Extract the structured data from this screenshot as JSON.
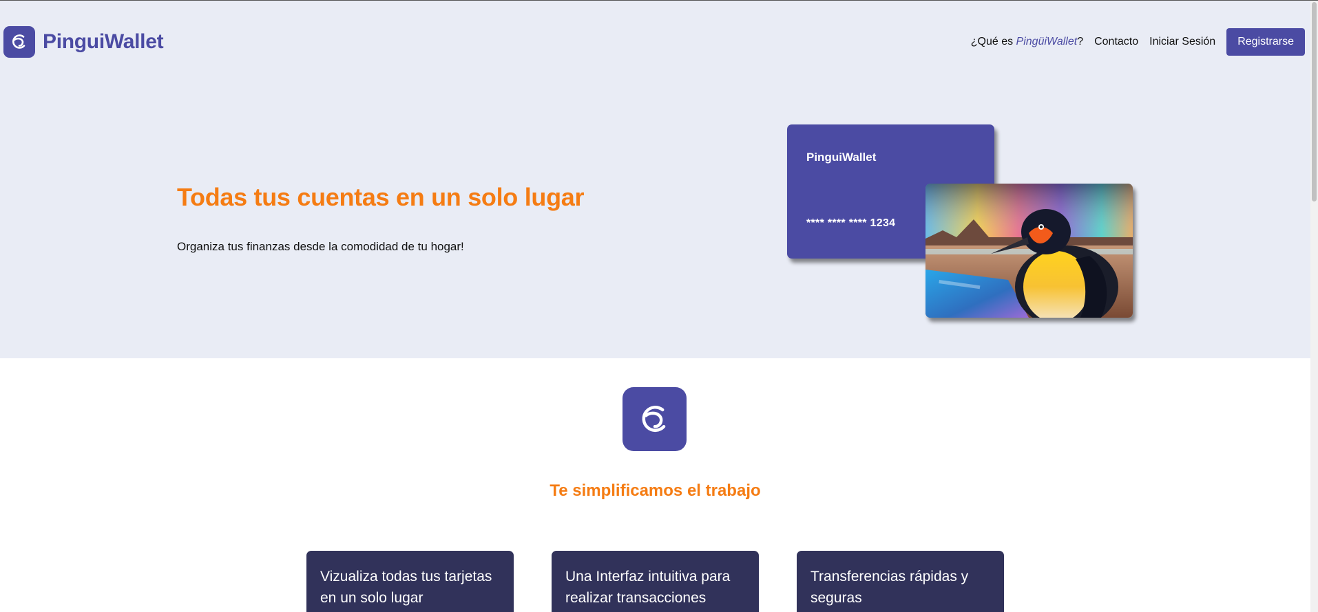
{
  "brand": {
    "name": "PinguiWallet",
    "logo_icon": "pingui-logo-icon"
  },
  "nav": {
    "que_es_prefix": "¿Qué es ",
    "que_es_brand": "PingüiWallet",
    "que_es_suffix": "?",
    "contact": "Contacto",
    "login": "Iniciar Sesión",
    "register": "Registrarse"
  },
  "hero": {
    "title": "Todas tus cuentas en un solo lugar",
    "subtitle": "Organiza tus finanzas desde la comodidad de tu hogar!"
  },
  "card": {
    "brand": "PinguiWallet",
    "number": "**** **** **** 1234"
  },
  "features": {
    "title": "Te simplificamos el trabajo",
    "items": [
      {
        "text": "Vizualiza todas tus tarjetas en un solo lugar"
      },
      {
        "text": "Una Interfaz intuitiva para realizar transacciones"
      },
      {
        "text": "Transferencias rápidas y seguras"
      }
    ]
  },
  "colors": {
    "brand": "#4b4ba3",
    "accent": "#f57c13",
    "hero_bg": "#e9ecf5",
    "feature_bg": "#31325a"
  }
}
